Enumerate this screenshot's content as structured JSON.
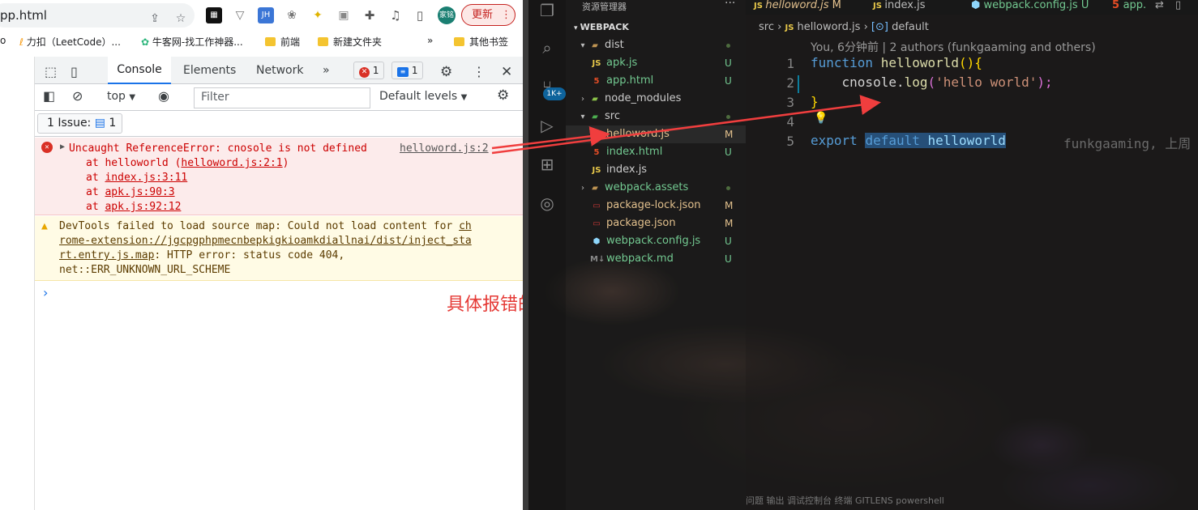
{
  "browser": {
    "url_fragment": "pp.html",
    "update_label": "更新",
    "profile_label": "家铭",
    "extensions": [
      "JH"
    ],
    "bookmarks": [
      {
        "label": "o"
      },
      {
        "label": "力扣（LeetCode）..."
      },
      {
        "label": "牛客网-找工作神器..."
      },
      {
        "label": "前端"
      },
      {
        "label": "新建文件夹"
      },
      {
        "label": "»"
      },
      {
        "label": "其他书签"
      }
    ]
  },
  "devtools": {
    "tabs": [
      "Console",
      "Elements",
      "Network",
      "»"
    ],
    "error_count": "1",
    "message_count": "1",
    "context": "top",
    "filter_placeholder": "Filter",
    "levels": "Default levels",
    "issues_label": "1 Issue:",
    "issues_count": "1",
    "error": {
      "message": "Uncaught ReferenceError: cnosole is not defined",
      "source": "helloword.js:2",
      "stack": [
        {
          "prefix": "at helloworld (",
          "link": "helloword.js:2:1",
          "suffix": ")"
        },
        {
          "prefix": "at ",
          "link": "index.js:3:11",
          "suffix": ""
        },
        {
          "prefix": "at ",
          "link": "apk.js:90:3",
          "suffix": ""
        },
        {
          "prefix": "at ",
          "link": "apk.js:92:12",
          "suffix": ""
        }
      ]
    },
    "warning": {
      "line1_text": "DevTools failed to load source map: Could not load content for ",
      "line1_link": "ch",
      "line2_link": "rome-extension://jgcpgphpmecnbepkigkioamkdiallnai/dist/inject_sta",
      "line3_link": "rt.entry.js.map",
      "line3_text": ": HTTP error: status code 404,",
      "line4_text": "net::ERR_UNKNOWN_URL_SCHEME"
    },
    "prompt": "›"
  },
  "annotation": "具体报错的位置",
  "vscode": {
    "explorer_title": "资源管理器",
    "root": "WEBPACK",
    "badge": "1K+",
    "tree": [
      {
        "label": "dist",
        "type": "folder",
        "status": "dot"
      },
      {
        "label": "apk.js",
        "type": "js",
        "status": "U"
      },
      {
        "label": "app.html",
        "type": "html",
        "status": "U"
      },
      {
        "label": "node_modules",
        "type": "folder",
        "status": ""
      },
      {
        "label": "src",
        "type": "folder",
        "status": "dot"
      },
      {
        "label": "helloword.js",
        "type": "js",
        "status": "M"
      },
      {
        "label": "index.html",
        "type": "html",
        "status": "U"
      },
      {
        "label": "index.js",
        "type": "js",
        "status": ""
      },
      {
        "label": "webpack.assets",
        "type": "folder",
        "status": "dot"
      },
      {
        "label": "package-lock.json",
        "type": "json",
        "status": "M"
      },
      {
        "label": "package.json",
        "type": "json",
        "status": "M"
      },
      {
        "label": "webpack.config.js",
        "type": "config",
        "status": "U"
      },
      {
        "label": "webpack.md",
        "type": "md",
        "status": "U"
      }
    ],
    "tabs": [
      {
        "label": "helloword.js",
        "status": "M",
        "icon": "JS"
      },
      {
        "label": "index.js",
        "status": "",
        "icon": "JS"
      },
      {
        "label": "webpack.config.js",
        "status": "U",
        "icon": "cfg"
      },
      {
        "label": "app.",
        "status": "",
        "icon": "html"
      }
    ],
    "breadcrumb": {
      "folder": "src",
      "file": "helloword.js",
      "symbol": "default"
    },
    "codelens": "You, 6分钟前 | 2 authors (funkgaaming and others)",
    "line_numbers": [
      "1",
      "2",
      "3",
      "4",
      "5"
    ],
    "code": {
      "l1_kw": "function",
      "l1_fn": "helloworld",
      "l1_punc": "(){",
      "l2_obj": "cnosole.",
      "l2_fn": "log",
      "l2_open": "(",
      "l2_str": "'hello world'",
      "l2_close": ");",
      "l3": "}",
      "l5_kw": "export",
      "l5_sel1": "default",
      "l5_sel2": "helloworld"
    },
    "blame": "funkgaaming, 上周",
    "panel_tabs": "问题    输出    调试控制台    终端    GITLENS                  powershell"
  }
}
